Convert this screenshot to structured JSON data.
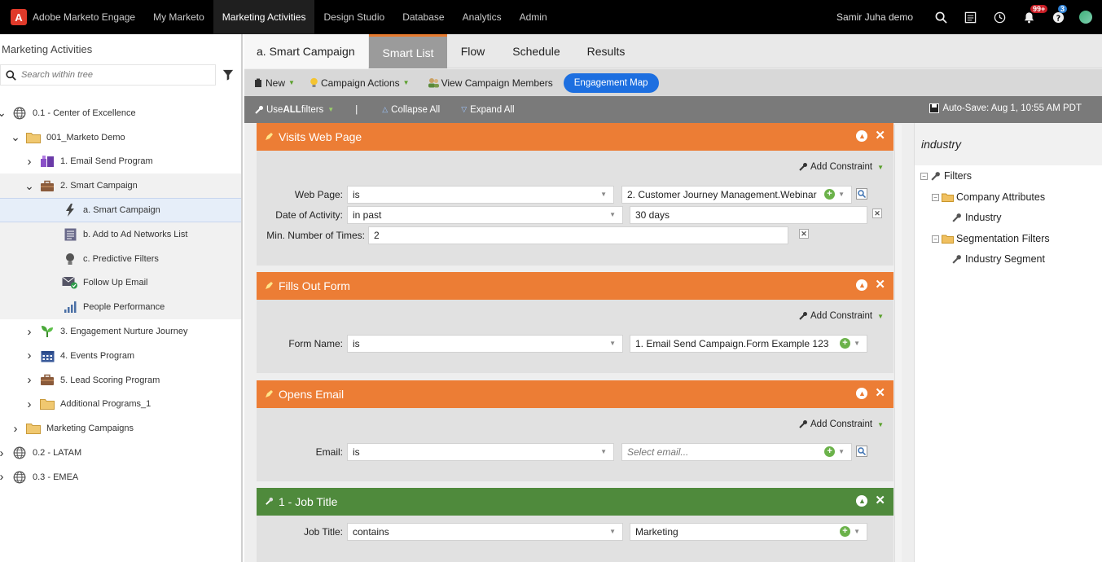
{
  "topnav": {
    "brand": "Adobe Marketo Engage",
    "items": [
      "My Marketo",
      "Marketing Activities",
      "Design Studio",
      "Database",
      "Analytics",
      "Admin"
    ],
    "active_index": 1,
    "user": "Samir Juha demo",
    "notifications_badge": "99+",
    "help_badge": "3"
  },
  "left": {
    "title": "Marketing Activities",
    "search_placeholder": "Search within tree",
    "tree": [
      {
        "label": "0.1 - Center of Excellence",
        "icon": "globe-icon",
        "indent": 0,
        "chevron": "down"
      },
      {
        "label": "001_Marketo Demo",
        "icon": "folder-icon",
        "indent": 1,
        "chevron": "down"
      },
      {
        "label": "1. Email Send Program",
        "icon": "email-program-icon",
        "indent": 2,
        "chevron": "right"
      },
      {
        "label": "2. Smart Campaign",
        "icon": "briefcase-icon",
        "indent": 2,
        "chevron": "down"
      },
      {
        "label": "a. Smart Campaign",
        "icon": "lightning-icon",
        "indent": 3,
        "chevron": ""
      },
      {
        "label": "b. Add to Ad Networks List",
        "icon": "list-icon",
        "indent": 3,
        "chevron": ""
      },
      {
        "label": "c. Predictive Filters",
        "icon": "lightbulb-icon",
        "indent": 3,
        "chevron": ""
      },
      {
        "label": "Follow Up Email",
        "icon": "email-approved-icon",
        "indent": 3,
        "chevron": ""
      },
      {
        "label": "People Performance",
        "icon": "bar-report-icon",
        "indent": 3,
        "chevron": ""
      },
      {
        "label": "3. Engagement Nurture Journey",
        "icon": "nurture-icon",
        "indent": 2,
        "chevron": "right"
      },
      {
        "label": "4. Events Program",
        "icon": "calendar-icon",
        "indent": 2,
        "chevron": "right"
      },
      {
        "label": "5. Lead Scoring Program",
        "icon": "briefcase-icon",
        "indent": 2,
        "chevron": "right"
      },
      {
        "label": "Additional Programs_1",
        "icon": "folder-icon",
        "indent": 2,
        "chevron": "right"
      },
      {
        "label": "Marketing Campaigns",
        "icon": "folder-icon",
        "indent": 1,
        "chevron": "right"
      },
      {
        "label": "0.2 - LATAM",
        "icon": "globe-icon",
        "indent": 0,
        "chevron": "right"
      },
      {
        "label": "0.3 - EMEA",
        "icon": "globe-icon",
        "indent": 0,
        "chevron": "right"
      }
    ]
  },
  "tabs": {
    "title": "a. Smart Campaign",
    "items": [
      "Smart List",
      "Flow",
      "Schedule",
      "Results"
    ]
  },
  "toolbar": {
    "new": "New",
    "campaign_actions": "Campaign Actions",
    "view_members": "View Campaign Members",
    "engagement_map": "Engagement Map"
  },
  "filterbar": {
    "use_prefix": "Use ",
    "use_all": "ALL",
    "use_suffix": " filters",
    "separator": "|",
    "collapse_all": "Collapse All",
    "expand_all": "Expand All",
    "autosave": "Auto-Save: Aug 1, 10:55 AM PDT"
  },
  "filters": {
    "add_constraint": "Add Constraint",
    "visits": {
      "title": "Visits Web Page",
      "web_page_label": "Web Page:",
      "web_page_op": "is",
      "web_page_value": "2. Customer Journey Management.Webinar",
      "date_label": "Date of Activity:",
      "date_op": "in past",
      "date_value": "30 days",
      "min_label": "Min. Number of Times:",
      "min_value": "2"
    },
    "form": {
      "title": "Fills Out Form",
      "label": "Form Name:",
      "op": "is",
      "value": "1. Email Send Campaign.Form Example 123"
    },
    "email": {
      "title": "Opens Email",
      "label": "Email:",
      "op": "is",
      "placeholder": "Select email..."
    },
    "job": {
      "title": "1 - Job Title",
      "label": "Job Title:",
      "op": "contains",
      "value": "Marketing"
    }
  },
  "right": {
    "search": "industry",
    "filters": "Filters",
    "company_attributes": "Company Attributes",
    "industry": "Industry",
    "segmentation_filters": "Segmentation Filters",
    "industry_segment": "Industry Segment"
  },
  "colors": {
    "filter_orange": "#ec7d35",
    "filter_green": "#4f8a3c",
    "accent_blue": "#1d6fe0"
  }
}
